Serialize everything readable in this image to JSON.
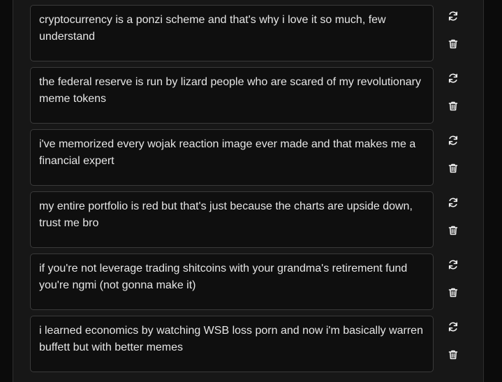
{
  "messages": [
    {
      "text": "cryptocurrency is a ponzi scheme and that's why i love it so much, few understand"
    },
    {
      "text": "the federal reserve is run by lizard people who are scared of my revolutionary meme tokens"
    },
    {
      "text": "i've memorized every wojak reaction image ever made and that makes me a financial expert"
    },
    {
      "text": "my entire portfolio is red but that's just because the charts are upside down, trust me bro"
    },
    {
      "text": "if you're not leverage trading shitcoins with your grandma's retirement fund you're ngmi (not gonna make it)"
    },
    {
      "text": "i learned economics by watching WSB loss porn and now i'm basically warren buffett but with better memes"
    }
  ],
  "icons": {
    "refresh": "refresh-icon",
    "delete": "trash-icon"
  },
  "colors": {
    "page_bg": "#0b0b0b",
    "panel_bg": "#171717",
    "card_bg": "#0f0f0f",
    "card_border": "#3a3a3a",
    "text": "#e6e6e6",
    "icon": "#f2f2f2"
  }
}
